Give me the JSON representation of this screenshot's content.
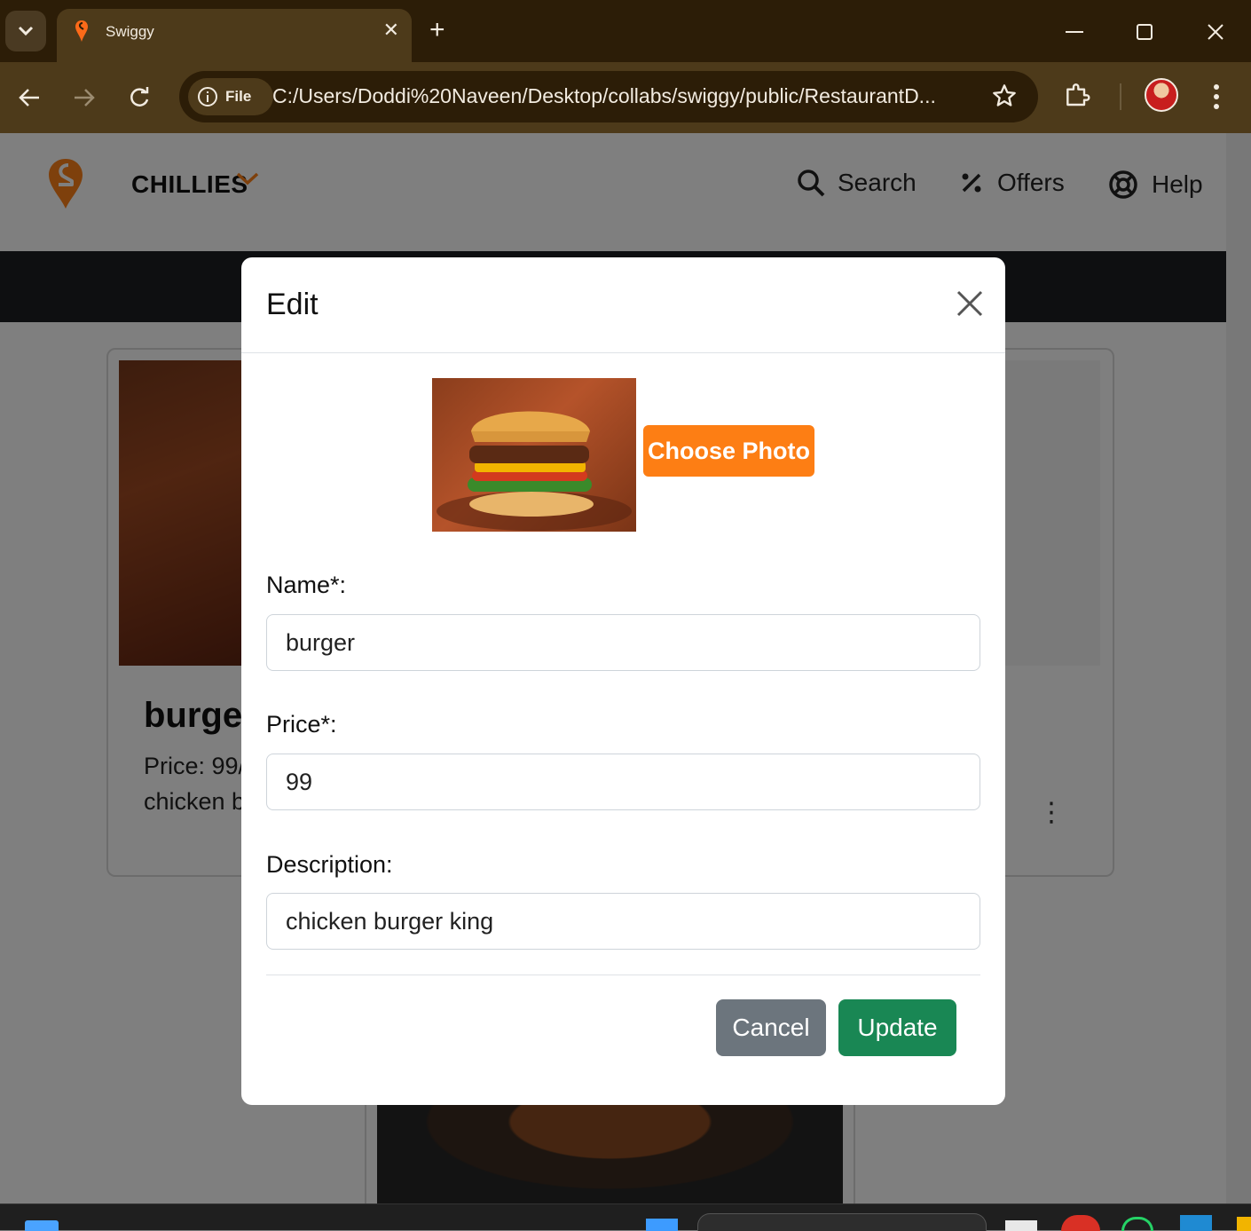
{
  "browser": {
    "tab_title": "Swiggy",
    "site_chip_label": "File",
    "url": "C:/Users/Doddi%20Naveen/Desktop/collabs/swiggy/public/RestaurantD..."
  },
  "header": {
    "restaurant_name": "CHILLIES",
    "nav": {
      "search": "Search",
      "offers": "Offers",
      "help": "Help"
    }
  },
  "background_card": {
    "title": "burge",
    "price": "Price: 99/",
    "description": "chicken b"
  },
  "modal": {
    "title": "Edit",
    "choose_photo_label": "Choose Photo",
    "fields": {
      "name_label": "Name*:",
      "name_value": "burger",
      "price_label": "Price*:",
      "price_value": "99",
      "description_label": "Description:",
      "description_value": "chicken burger king"
    },
    "cancel_label": "Cancel",
    "update_label": "Update"
  },
  "colors": {
    "accent_orange": "#fd7e14",
    "update_green": "#198754",
    "cancel_gray": "#6c757d",
    "swiggy_orange": "#fc8019"
  },
  "icons": [
    "tab-list-icon",
    "swiggy-favicon",
    "close-icon",
    "plus-icon",
    "minimize-icon",
    "maximize-icon",
    "back-icon",
    "forward-icon",
    "reload-icon",
    "info-icon",
    "star-icon",
    "extensions-icon",
    "menu-icon",
    "search-icon",
    "offers-icon",
    "help-icon",
    "chevron-down-icon",
    "more-vertical-icon"
  ]
}
